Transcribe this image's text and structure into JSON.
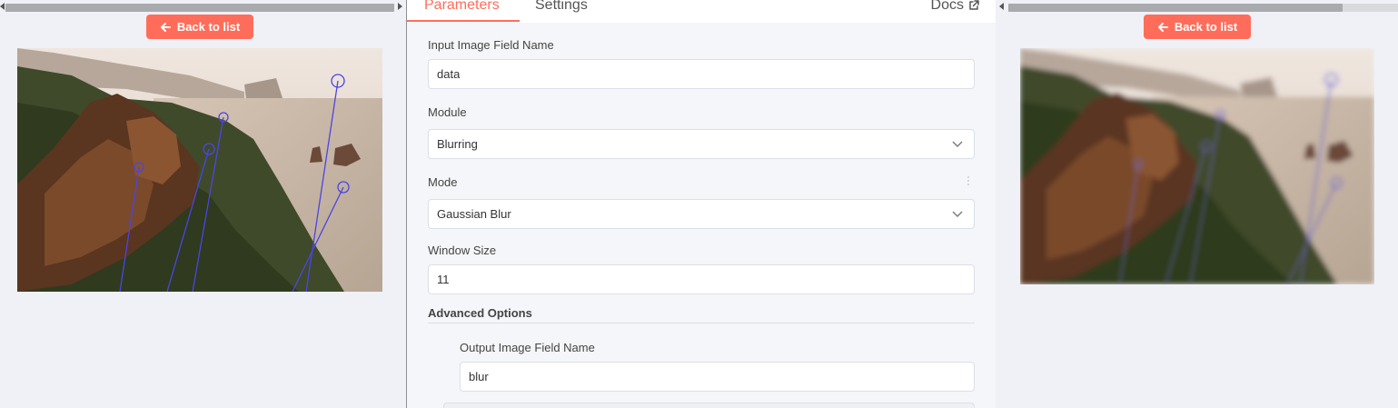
{
  "input_panel": {
    "back_label": "Back to list"
  },
  "output_panel": {
    "back_label": "Back to list"
  },
  "tabs": {
    "parameters": "Parameters",
    "settings": "Settings",
    "docs": "Docs"
  },
  "form": {
    "input_field": {
      "label": "Input Image Field Name",
      "value": "data"
    },
    "module": {
      "label": "Module",
      "value": "Blurring"
    },
    "mode": {
      "label": "Mode",
      "value": "Gaussian Blur"
    },
    "window_size": {
      "label": "Window Size",
      "value": "11"
    },
    "advanced": {
      "title": "Advanced Options"
    },
    "output_field": {
      "label": "Output Image Field Name",
      "value": "blur"
    }
  },
  "colors": {
    "accent": "#ff6d5a",
    "keypoint_lines": "#4b45e6"
  },
  "icons": [
    "arrow-left-icon",
    "external-link-icon",
    "chevron-down-icon",
    "drag-handle-icon"
  ]
}
